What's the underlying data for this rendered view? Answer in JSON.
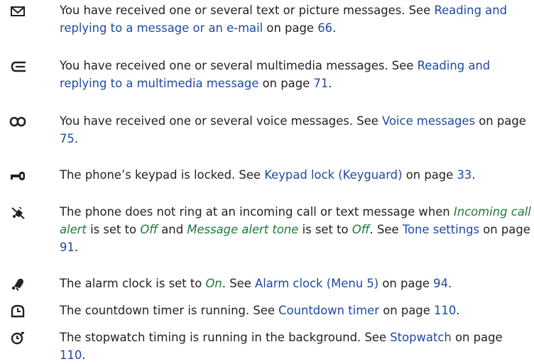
{
  "entries": [
    {
      "icon": "envelope-icon",
      "parts": [
        {
          "t": "You have received one or several text or picture messages. See "
        },
        {
          "t": "Reading and replying to a message or an e-mail",
          "k": "link"
        },
        {
          "t": " on page "
        },
        {
          "t": "66",
          "k": "link"
        },
        {
          "t": "."
        }
      ]
    },
    {
      "icon": "multimedia-message-icon",
      "parts": [
        {
          "t": "You have received one or several multimedia messages. See "
        },
        {
          "t": "Reading and replying to a multimedia message",
          "k": "link"
        },
        {
          "t": " on page "
        },
        {
          "t": "71",
          "k": "link"
        },
        {
          "t": "."
        }
      ]
    },
    {
      "icon": "voicemail-icon",
      "parts": [
        {
          "t": "You have received one or several voice messages. See "
        },
        {
          "t": "Voice messages",
          "k": "link"
        },
        {
          "t": " on page "
        },
        {
          "t": "75",
          "k": "link"
        },
        {
          "t": "."
        }
      ]
    },
    {
      "icon": "key-lock-icon",
      "parts": [
        {
          "t": "The phone’s keypad is locked. See "
        },
        {
          "t": "Keypad lock (Keyguard)",
          "k": "link"
        },
        {
          "t": " on page "
        },
        {
          "t": "33",
          "k": "link"
        },
        {
          "t": "."
        }
      ]
    },
    {
      "icon": "silent-bell-icon",
      "parts": [
        {
          "t": "The phone does not ring at an incoming call or text message when "
        },
        {
          "t": "Incoming call alert",
          "k": "em"
        },
        {
          "t": " is set to "
        },
        {
          "t": "Off",
          "k": "em"
        },
        {
          "t": " and "
        },
        {
          "t": "Message alert tone",
          "k": "em"
        },
        {
          "t": " is set to "
        },
        {
          "t": "Off",
          "k": "em"
        },
        {
          "t": ". See "
        },
        {
          "t": "Tone settings",
          "k": "link"
        },
        {
          "t": " on page "
        },
        {
          "t": "91",
          "k": "link"
        },
        {
          "t": "."
        }
      ]
    },
    {
      "icon": "alarm-bell-icon",
      "parts": [
        {
          "t": "The alarm clock is set to "
        },
        {
          "t": "On",
          "k": "em"
        },
        {
          "t": ". See "
        },
        {
          "t": "Alarm clock (Menu 5)",
          "k": "link"
        },
        {
          "t": " on page "
        },
        {
          "t": "94",
          "k": "link"
        },
        {
          "t": "."
        }
      ]
    },
    {
      "icon": "countdown-timer-icon",
      "parts": [
        {
          "t": "The countdown timer is running. See "
        },
        {
          "t": "Countdown timer",
          "k": "link"
        },
        {
          "t": " on page "
        },
        {
          "t": "110",
          "k": "link"
        },
        {
          "t": "."
        }
      ]
    },
    {
      "icon": "stopwatch-icon",
      "parts": [
        {
          "t": "The stopwatch timing is running in the background. See "
        },
        {
          "t": "Stopwatch",
          "k": "link"
        },
        {
          "t": " on page "
        },
        {
          "t": "110",
          "k": "link"
        },
        {
          "t": "."
        }
      ]
    }
  ]
}
